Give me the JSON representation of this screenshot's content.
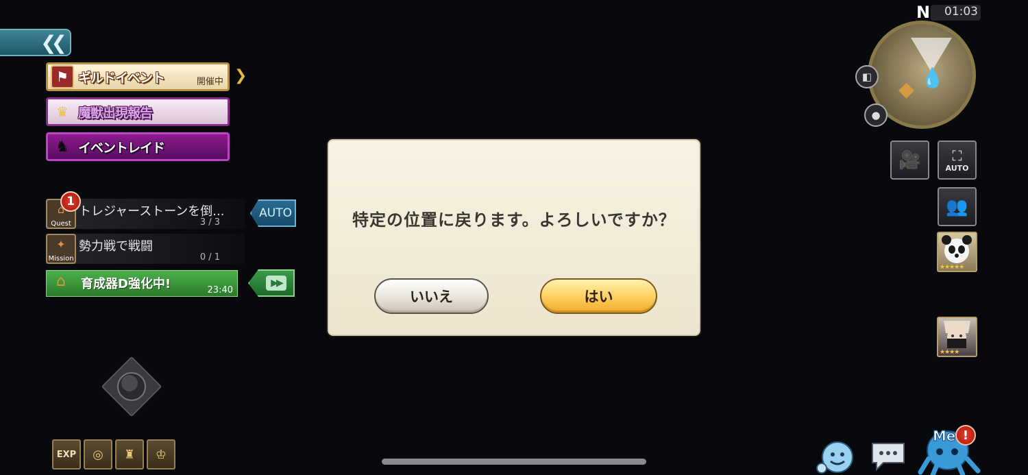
{
  "hud": {
    "clock": "01:03",
    "compass": "N"
  },
  "events": {
    "guild": {
      "label": "ギルドイベント",
      "status": "開催中"
    },
    "beast": {
      "label": "魔獣出現報告"
    },
    "raid": {
      "label": "イベントレイド"
    }
  },
  "quests": {
    "quest": {
      "icon_label": "Quest",
      "badge": "1",
      "title": "トレジャーストーンを倒...",
      "progress": "3 / 3"
    },
    "auto_label": "AUTO",
    "mission": {
      "icon_label": "Mission",
      "title": "勢力戦で戦闘",
      "progress": "0 / 1"
    },
    "boost": {
      "title": "育成器D強化中!",
      "timer": "23:40"
    }
  },
  "bottom_left": {
    "exp_label": "EXP"
  },
  "right_panel": {
    "auto_camera_label": "AUTO",
    "portraits": [
      {
        "name": "panda-character",
        "stars": "★★★★★"
      },
      {
        "name": "masked-character",
        "stars": "★★★★"
      }
    ]
  },
  "dialog": {
    "message": "特定の位置に戻ります。よろしいですか？",
    "no_label": "いいえ",
    "yes_label": "はい"
  },
  "bottom_right": {
    "me_label": "Me",
    "me_alert": "!"
  },
  "colors": {
    "dialog_bg": "#f4eedd",
    "yes_button": "#ffcf5c",
    "raid_banner": "#7a147c",
    "beast_banner": "#8a2b8a",
    "guild_banner": "#b8913e",
    "boost_banner": "#3f9a3f",
    "auto_button": "#2a6a90"
  }
}
